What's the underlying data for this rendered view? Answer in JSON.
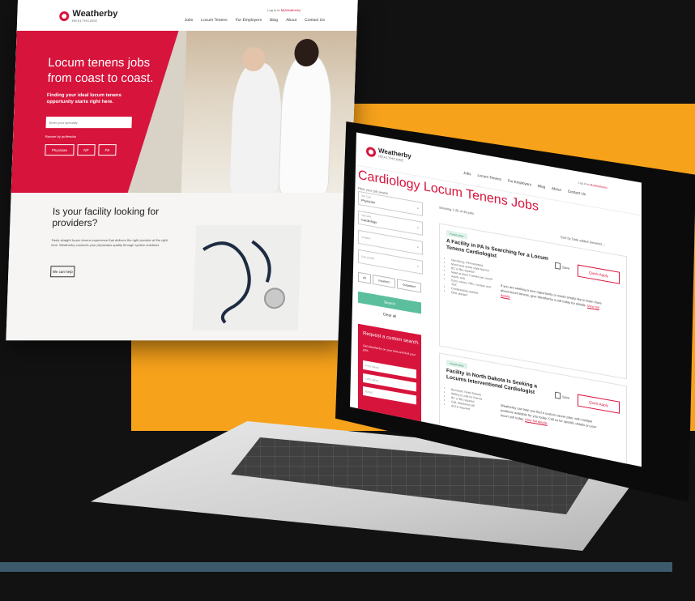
{
  "colors": {
    "brand_red": "#d7143c",
    "accent_orange": "#f7a21b",
    "search_green": "#5bbf9e"
  },
  "homepage": {
    "logo": {
      "name": "Weatherby",
      "sub": "HEALTHCARE"
    },
    "login": {
      "prefix": "Log in to",
      "link": "MyWeatherby"
    },
    "nav": [
      "Jobs",
      "Locum Tenens",
      "For Employers",
      "Blog",
      "About",
      "Contact Us"
    ],
    "hero": {
      "title": "Locum tenens jobs from coast to coast.",
      "subtitle": "Finding your ideal locum tenens opportunity starts right here.",
      "search_placeholder": "Enter your specialty",
      "profession_label": "Browse by profession",
      "pills": [
        "Physician",
        "NP",
        "PA"
      ]
    },
    "facility": {
      "title": "Is your facility looking for providers?",
      "text": "Fasts straight locum tenens experience that delivers the right provider at the right time. Weatherby connects your physicians quality through system solutions.",
      "button": "We can help"
    }
  },
  "search_page": {
    "logo": {
      "name": "Weatherby",
      "sub": "HEALTHCARE"
    },
    "login": {
      "prefix": "Log in to",
      "link": "MyWeatherby"
    },
    "nav": [
      "Jobs",
      "Locum Tenens",
      "For Employers",
      "Blog",
      "About",
      "Contact Us"
    ],
    "page_title": "Cardiology Locum Tenens Jobs",
    "filter_label": "Filter your job search",
    "fields": [
      {
        "label": "Job Type",
        "value": "Physician"
      },
      {
        "label": "Specialty",
        "value": "Cardiology"
      },
      {
        "label": "Location",
        "value": ""
      },
      {
        "label": "Date posted",
        "value": ""
      }
    ],
    "tags": [
      "All",
      "Inpatient",
      "Outpatient"
    ],
    "search_button": "Search",
    "clear_all": "Clear all",
    "custom_search": {
      "title": "Request a custom search.",
      "text": "Get Weatherby on your time and find your jobs.",
      "inputs": [
        "First name",
        "Last name",
        "Email"
      ]
    },
    "results_count": "Showing 1-25 of 49 jobs",
    "sort_label": "Sort by",
    "sort_value": "Date added (newest)",
    "cards": [
      {
        "badge": "Posted today",
        "title": "A Facility in PA Is Searching for a Locum Tenens Cardiologist",
        "bullets": [
          "Harrisburg, Pennsylvania",
          "Must have active state license",
          "BC or BE required",
          "Need at least 2 weeks per month",
          "Adults only",
          "Echo, stress, ORL, nuclear and TEE",
          "Credentialing needed",
          "DEA needed"
        ],
        "desc": "If you are seeking a new opportunity or would simply like to learn more about locum tenens, give Weatherby a call today for details.",
        "desc_link": "View full details",
        "save": "Save",
        "apply": "Quick Apply"
      },
      {
        "badge": "Posted today",
        "title": "Facility in North Dakota Is Seeking a Locums Interventional Cardiologist",
        "bullets": [
          "Bismarck, North Dakota",
          "Willing to wait for license",
          "BC or BE required",
          "Call, Weekend call",
          "ACLS required"
        ],
        "desc": "Weatherby can help you find a custom career plan, with multiple positions available for you today. Call us for specific details on your locum job today.",
        "desc_link": "View full details",
        "save": "Save",
        "apply": "Quick Apply"
      }
    ]
  }
}
